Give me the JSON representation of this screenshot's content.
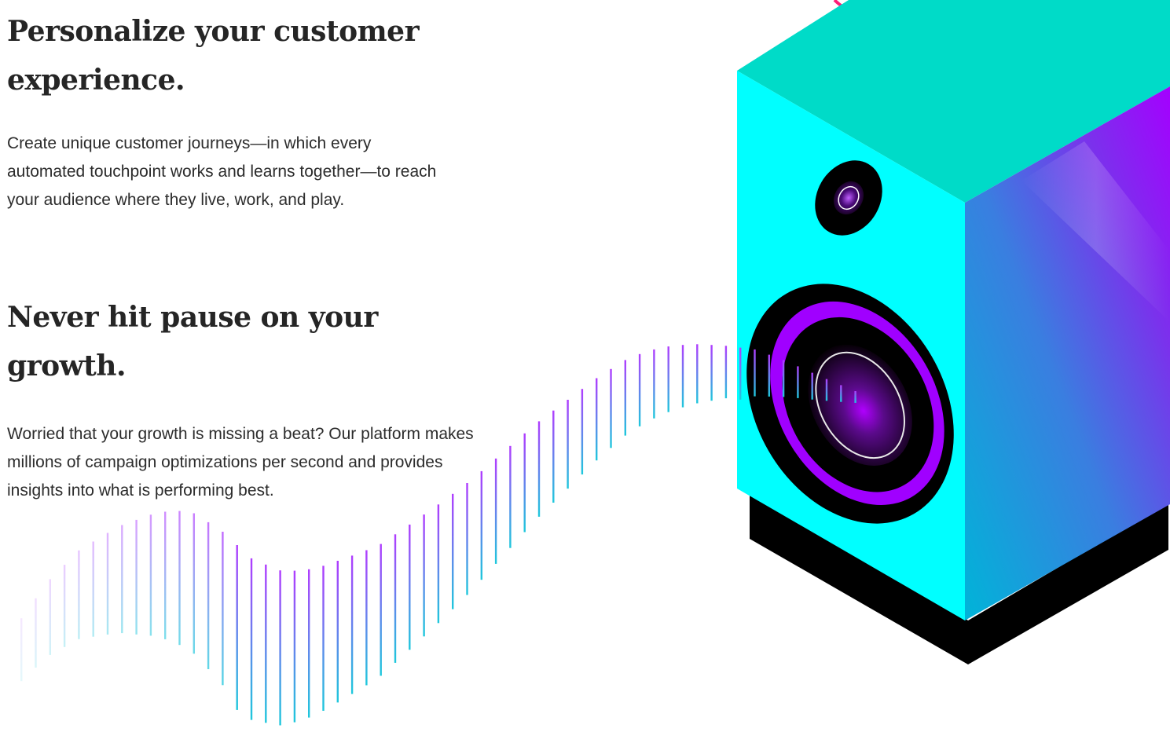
{
  "sections": [
    {
      "heading": "Personalize your customer experience.",
      "body": "Create unique customer journeys—in which every automated touchpoint works and learns together—to reach your audience where they live, work, and play."
    },
    {
      "heading": "Never hit pause on your growth.",
      "body": "Worried that your growth is missing a beat? Our platform makes millions of campaign optimizations per second and provides insights into what is performing best."
    }
  ],
  "illustration": {
    "name": "speaker-soundwave-illustration",
    "colors": {
      "speaker_front": "#00ffff",
      "speaker_top": "#00dbc8",
      "speaker_side_start": "#0aa4d8",
      "speaker_side_end": "#9f00ff",
      "speaker_base": "#000000",
      "woofer_ring": "#a000ff",
      "wave_purple": "#b03cff",
      "wave_cyan": "#1ec8dc",
      "cable": "#ff1e78"
    }
  }
}
